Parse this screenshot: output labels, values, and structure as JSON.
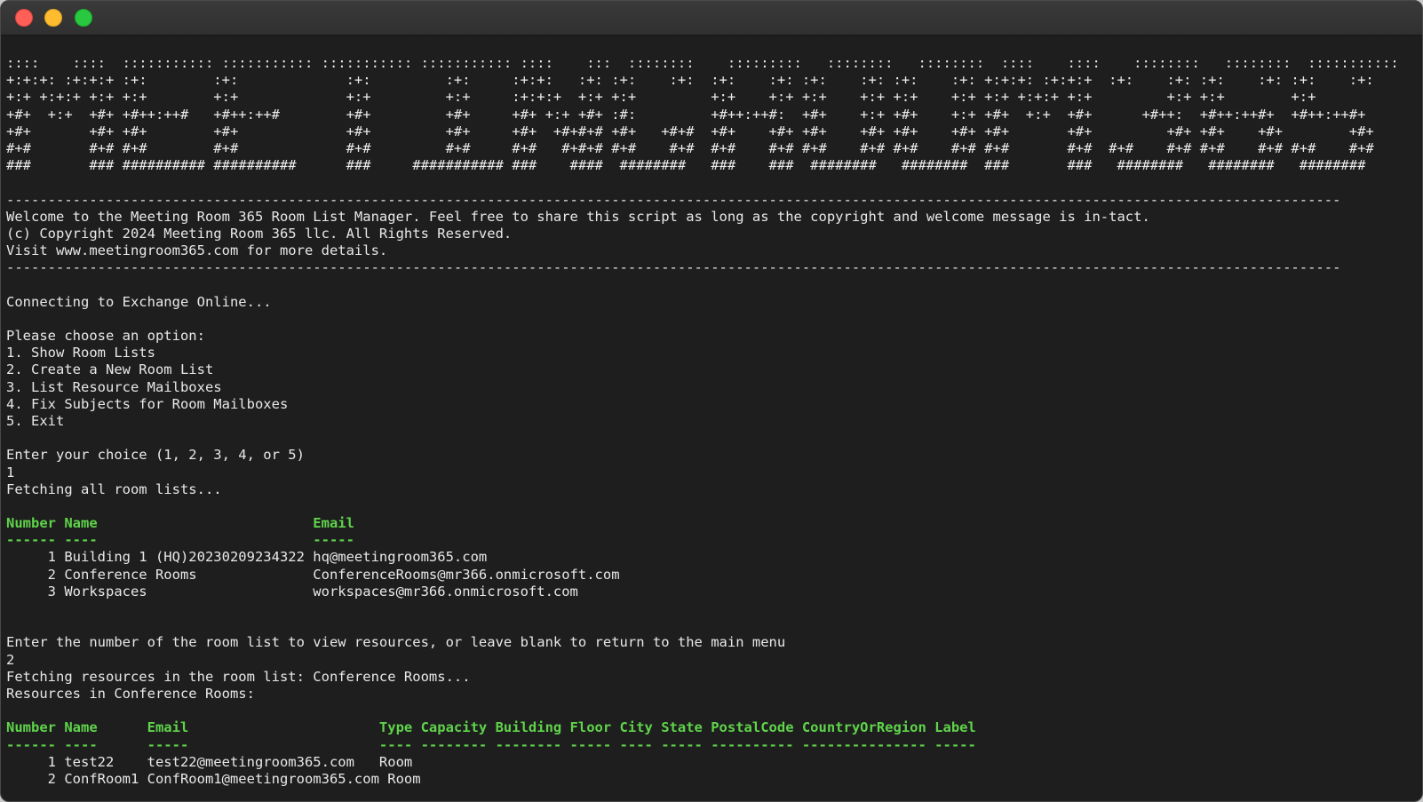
{
  "window": {
    "controls": {
      "close": "close",
      "minimize": "minimize",
      "zoom": "zoom"
    }
  },
  "terminal": {
    "banner": [
      "::::    ::::  ::::::::::: ::::::::::: ::::::::::: ::::::::::: ::::    :::  ::::::::    :::::::::   ::::::::   ::::::::  ::::    ::::    ::::::::   ::::::::  :::::::::::",
      "+:+:+: :+:+:+ :+:        :+:             :+:         :+:     :+:+:   :+: :+:    :+:  :+:    :+: :+:    :+: :+:    :+: +:+:+: :+:+:+  :+:    :+: :+:    :+: :+:    :+:",
      "+:+ +:+:+ +:+ +:+        +:+             +:+         +:+     :+:+:+  +:+ +:+         +:+    +:+ +:+    +:+ +:+    +:+ +:+ +:+:+ +:+         +:+ +:+        +:+",
      "+#+  +:+  +#+ +#++:++#   +#++:++#        +#+         +#+     +#+ +:+ +#+ :#:         +#++:++#:  +#+    +:+ +#+    +:+ +#+  +:+  +#+      +#++:  +#++:++#+  +#++:++#+",
      "+#+       +#+ +#+        +#+             +#+         +#+     +#+  +#+#+# +#+   +#+#  +#+    +#+ +#+    +#+ +#+    +#+ +#+       +#+         +#+ +#+    +#+        +#+",
      "#+#       #+# #+#        #+#             #+#         #+#     #+#   #+#+# #+#    #+#  #+#    #+# #+#    #+# #+#    #+# #+#       #+#  #+#    #+# #+#    #+# #+#    #+#",
      "###       ### ########## ##########      ###     ########### ###    ####  ########   ###    ###  ########   ########  ###       ###   ########   ########   ########"
    ],
    "divider": "-----------------------------------------------------------------------------------------------------------------------------------------------------------------",
    "welcome": [
      "Welcome to the Meeting Room 365 Room List Manager. Feel free to share this script as long as the copyright and welcome message is in-tact.",
      "(c) Copyright 2024 Meeting Room 365 llc. All Rights Reserved.",
      "Visit www.meetingroom365.com for more details."
    ],
    "connecting": "Connecting to Exchange Online...",
    "menu_prompt": "Please choose an option:",
    "menu_options": [
      "1. Show Room Lists",
      "2. Create a New Room List",
      "3. List Resource Mailboxes",
      "4. Fix Subjects for Room Mailboxes",
      "5. Exit"
    ],
    "choice_prompt": "Enter your choice (1, 2, 3, 4, or 5)",
    "choice_input": "1",
    "fetching_lists": "Fetching all room lists...",
    "room_lists_table": {
      "header": "Number Name                          Email",
      "underline": "------ ----                          -----",
      "rows": [
        "     1 Building 1 (HQ)20230209234322 hq@meetingroom365.com",
        "     2 Conference Rooms              ConferenceRooms@mr366.onmicrosoft.com",
        "     3 Workspaces                    workspaces@mr366.onmicrosoft.com"
      ]
    },
    "list_prompt": "Enter the number of the room list to view resources, or leave blank to return to the main menu",
    "list_input": "2",
    "fetching_resources": "Fetching resources in the room list: Conference Rooms...",
    "resources_heading": "Resources in Conference Rooms:",
    "resources_table": {
      "header": "Number Name      Email                       Type Capacity Building Floor City State PostalCode CountryOrRegion Label",
      "underline": "------ ----      -----                       ---- -------- -------- ----- ---- ----- ---------- --------------- -----",
      "rows": [
        "     1 test22    test22@meetingroom365.com   Room",
        "     2 ConfRoom1 ConfRoom1@meetingroom365.com Room"
      ]
    }
  }
}
